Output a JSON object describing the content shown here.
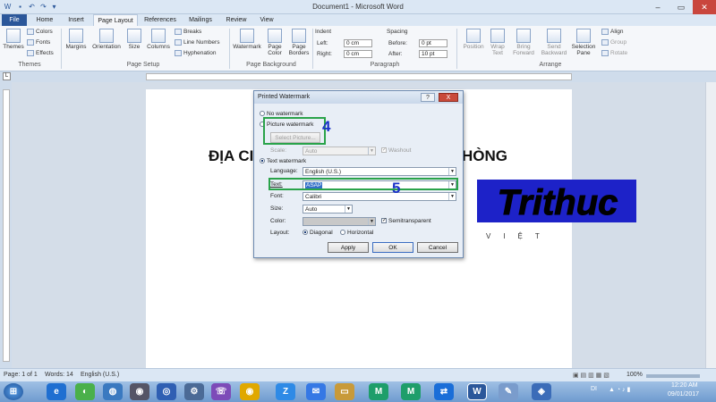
{
  "window": {
    "title": "Document1 - Microsoft Word"
  },
  "tabs": [
    "File",
    "Home",
    "Insert",
    "Page Layout",
    "References",
    "Mailings",
    "Review",
    "View"
  ],
  "ribbon": {
    "themes": {
      "themes_label": "Themes",
      "colors": "Colors",
      "fonts": "Fonts",
      "effects": "Effects",
      "group": "Themes"
    },
    "page_setup": {
      "margins": "Margins",
      "orientation": "Orientation",
      "size": "Size",
      "columns": "Columns",
      "breaks": "Breaks",
      "line_numbers": "Line Numbers",
      "hyphenation": "Hyphenation",
      "group": "Page Setup"
    },
    "page_background": {
      "watermark": "Watermark",
      "page_color": "Page Color",
      "page_borders": "Page Borders",
      "group": "Page Background"
    },
    "paragraph": {
      "indent": "Indent",
      "left": "Left:",
      "left_val": "0 cm",
      "right": "Right:",
      "right_val": "0 cm",
      "spacing": "Spacing",
      "before": "Before:",
      "before_val": "0 pt",
      "after": "After:",
      "after_val": "10 pt",
      "group": "Paragraph"
    },
    "arrange": {
      "position": "Position",
      "wrap_text": "Wrap Text",
      "bring_forward": "Bring Forward",
      "send_backward": "Send Backward",
      "selection_pane": "Selection Pane",
      "align": "Align",
      "group_btn": "Group",
      "rotate": "Rotate",
      "group": "Arrange"
    }
  },
  "document": {
    "heading_left": "ĐỊA CI",
    "heading_right": "HÒNG"
  },
  "logo": {
    "text": "Trithuc",
    "subtext": "VIỆT"
  },
  "dialog": {
    "title": "Printed Watermark",
    "no_watermark": "No watermark",
    "picture_watermark": "Picture watermark",
    "select_picture": "Select Picture...",
    "scale_label": "Scale:",
    "scale_value": "Auto",
    "washout": "Washout",
    "text_watermark": "Text watermark",
    "language_label": "Language:",
    "language_value": "English (U.S.)",
    "text_label": "Text:",
    "text_value": "ASAP",
    "font_label": "Font:",
    "font_value": "Calibri",
    "size_label": "Size:",
    "size_value": "Auto",
    "color_label": "Color:",
    "semitransparent": "Semitransparent",
    "layout_label": "Layout:",
    "diagonal": "Diagonal",
    "horizontal": "Horizontal",
    "apply": "Apply",
    "ok": "OK",
    "cancel": "Cancel",
    "help": "?",
    "close": "X",
    "selected_watermark": "text",
    "selected_layout": "diagonal"
  },
  "annotations": {
    "step4": "4",
    "step5": "5",
    "color": "#2aa34a"
  },
  "status": {
    "page": "Page: 1 of 1",
    "words": "Words: 14",
    "language": "English (U.S.)",
    "zoom": "100%"
  },
  "taskbar": {
    "apps": [
      "start-orb",
      "ie",
      "coccoc",
      "network",
      "viber",
      "chrome",
      "zalo",
      "messenger",
      "files",
      "mtb",
      "mtb2",
      "teamviewer",
      "word",
      "paint",
      "tax"
    ],
    "tray_lang": "DI",
    "time": "12:20 AM",
    "date": "09/01/2017"
  },
  "colors": {
    "accent": "#2b579a",
    "logo_blue": "#1d22c8"
  }
}
